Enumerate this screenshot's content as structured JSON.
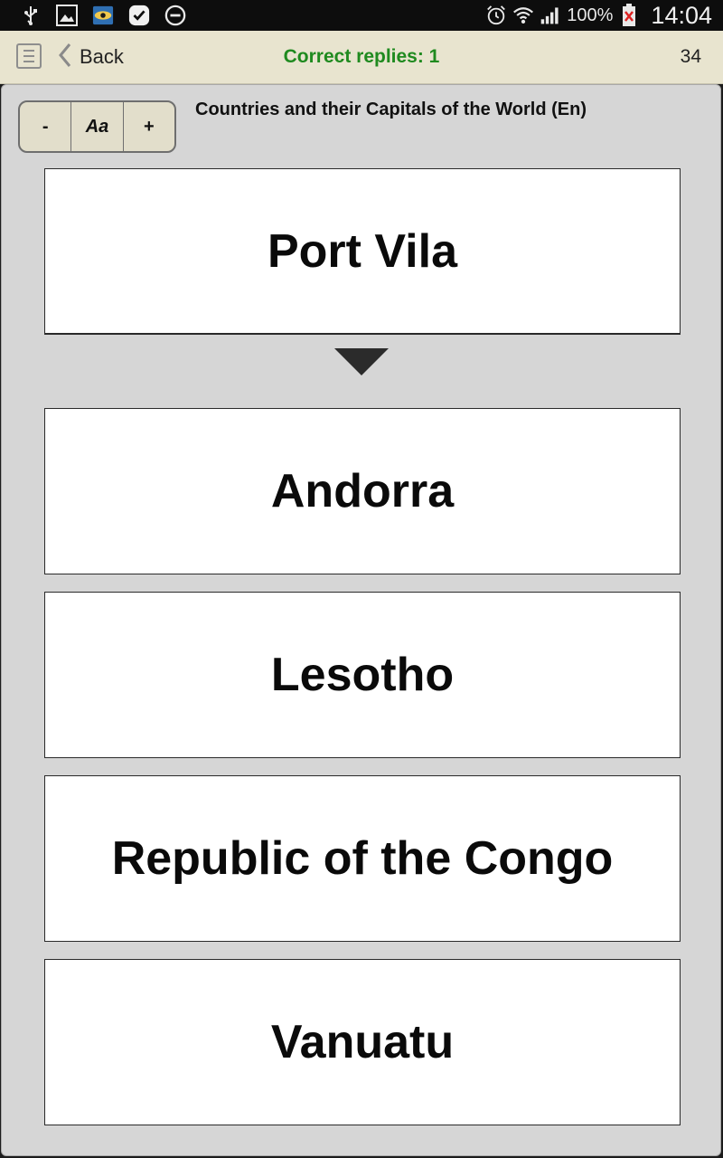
{
  "status_bar": {
    "battery_text": "100%",
    "time": "14:04",
    "left_icons": [
      "usb-icon",
      "gallery-icon",
      "app-eye-icon",
      "check-badge-icon",
      "do-not-disturb-icon"
    ],
    "right_icons": [
      "alarm-icon",
      "wifi-icon",
      "signal-icon",
      "battery-icon"
    ]
  },
  "action_bar": {
    "back_label": "Back",
    "score": "Correct replies: 1",
    "count": "34",
    "score_color": "#1f8a1f"
  },
  "toolbar": {
    "decrease_label": "-",
    "font_label": "Aa",
    "increase_label": "+"
  },
  "deck_title": "Countries and their Capitals of the World (En)",
  "question": "Port Vila",
  "answers": [
    "Andorra",
    "Lesotho",
    "Republic of the Congo",
    "Vanuatu"
  ]
}
